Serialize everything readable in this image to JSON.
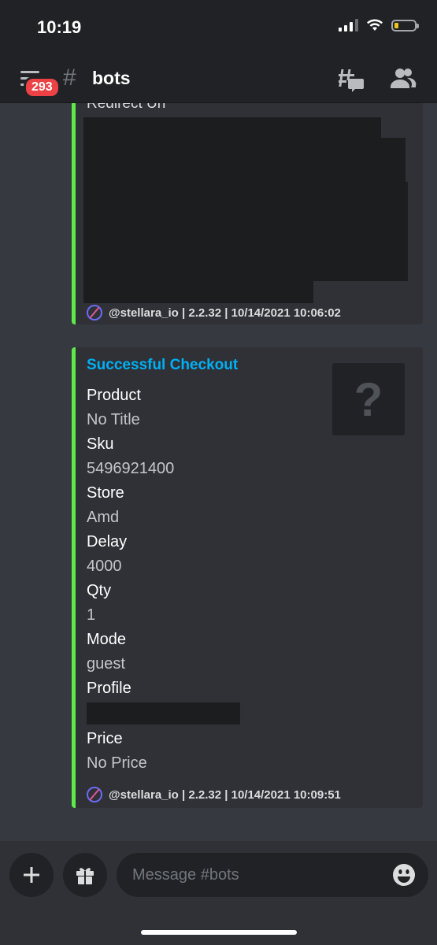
{
  "status_bar": {
    "time": "10:19"
  },
  "header": {
    "badge_count": "293",
    "channel_hash": "#",
    "channel_name": "bots"
  },
  "messages": [
    {
      "partial_field_name": "Redirect Url",
      "footer": "@stellara_io | 2.2.32 | 10/14/2021 10:06:02",
      "accent_color": "#5eeb4a"
    },
    {
      "title": "Successful Checkout",
      "title_color": "#00b0f4",
      "fields": [
        {
          "name": "Product",
          "value": "No Title"
        },
        {
          "name": "Sku",
          "value": "5496921400"
        },
        {
          "name": "Store",
          "value": "Amd"
        },
        {
          "name": "Delay",
          "value": "4000"
        },
        {
          "name": "Qty",
          "value": "1"
        },
        {
          "name": "Mode",
          "value": "guest"
        },
        {
          "name": "Profile",
          "value": ""
        },
        {
          "name": "Price",
          "value": "No Price"
        }
      ],
      "thumbnail": "?",
      "footer": "@stellara_io | 2.2.32 | 10/14/2021 10:09:51",
      "accent_color": "#5eeb4a"
    }
  ],
  "composer": {
    "placeholder": "Message #bots"
  }
}
